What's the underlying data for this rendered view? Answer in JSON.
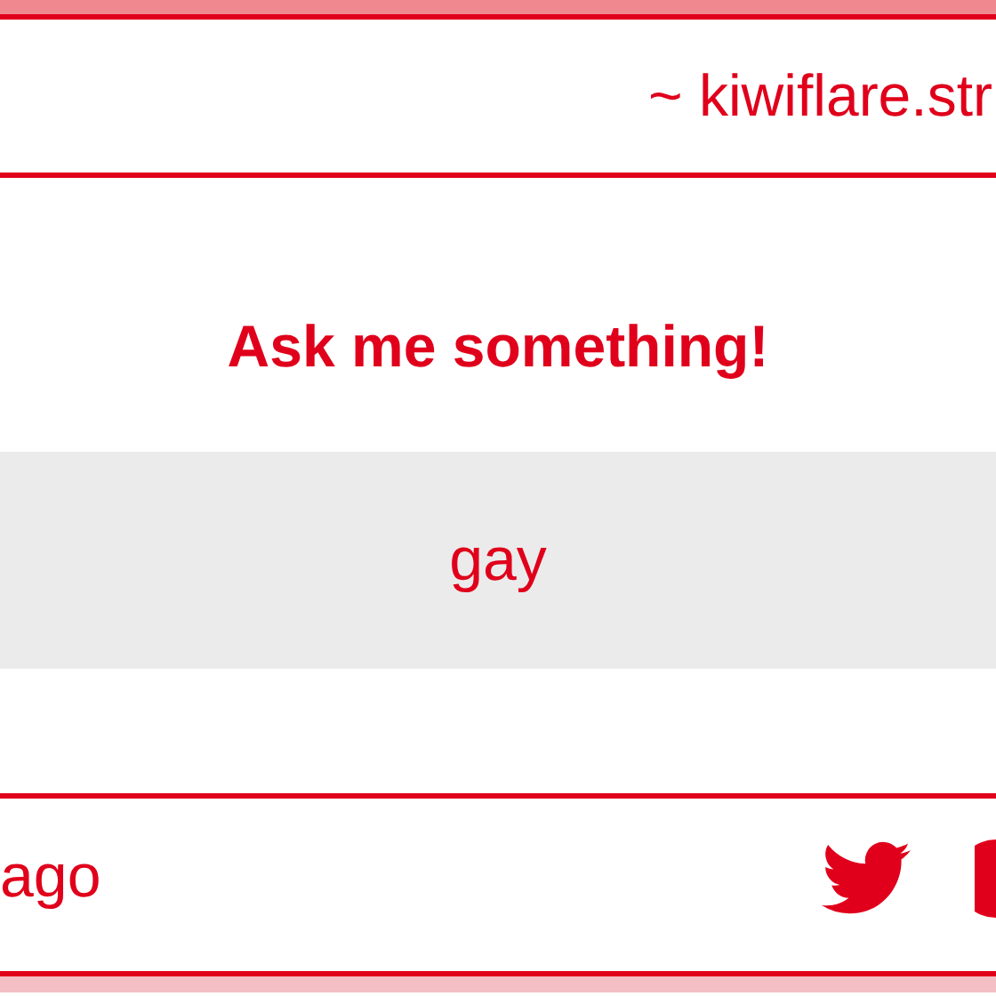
{
  "header": {
    "text": "~ kiwiflare.str"
  },
  "question_box": {
    "title": "Ask me something!",
    "question": "gay"
  },
  "footer": {
    "time": "ago"
  }
}
